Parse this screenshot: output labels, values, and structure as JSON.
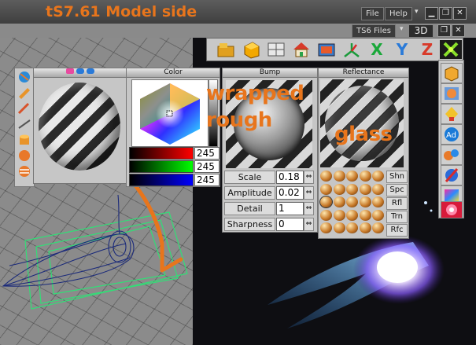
{
  "app": {
    "title": "tS7.61 Model side",
    "menu": [
      {
        "label": "File"
      },
      {
        "label": "Help"
      }
    ],
    "files_button": "TS6 Files",
    "view_button": "3D"
  },
  "annotations": {
    "wrapped": "wrapped",
    "rough": "rough",
    "glass": "glass"
  },
  "color_panel": {
    "header": "Color",
    "red": "245",
    "green": "245",
    "blue": "245"
  },
  "bump_panel": {
    "header": "Bump",
    "params": [
      {
        "label": "Scale",
        "value": "0.18"
      },
      {
        "label": "Amplitude",
        "value": "0.02"
      },
      {
        "label": "Detail",
        "value": "1"
      },
      {
        "label": "Sharpness",
        "value": "0"
      }
    ]
  },
  "reflectance_panel": {
    "header": "Reflectance",
    "buttons": [
      "Shn",
      "Spc",
      "Rfl",
      "Trn",
      "Rfc"
    ]
  },
  "colors": {
    "accent": "#e8751c",
    "viewport_dark": "#0e0e12",
    "grid_bg": "#8b8b8b",
    "wire_green": "#33dd77",
    "wire_blue": "#1b2a7a"
  }
}
